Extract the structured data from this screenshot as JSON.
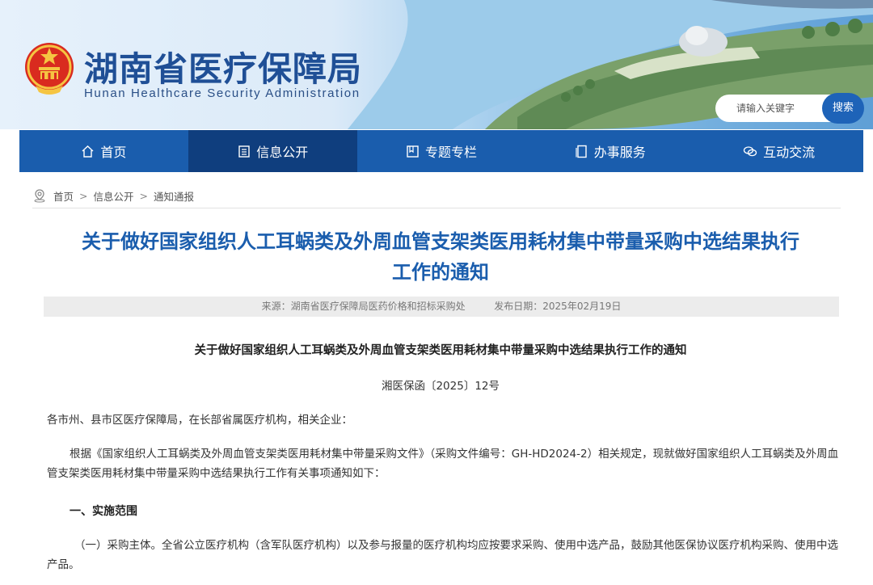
{
  "header": {
    "site_title": "湖南省医疗保障局",
    "site_subtitle": "Hunan Healthcare Security Administration",
    "search_placeholder": "请输入关键字",
    "search_button": "搜索"
  },
  "nav": {
    "items": [
      {
        "label": "首页",
        "icon": "home-icon",
        "active": false
      },
      {
        "label": "信息公开",
        "icon": "list-icon",
        "active": true
      },
      {
        "label": "专题专栏",
        "icon": "book-icon",
        "active": false
      },
      {
        "label": "办事服务",
        "icon": "document-icon",
        "active": false
      },
      {
        "label": "互动交流",
        "icon": "chat-icon",
        "active": false
      }
    ]
  },
  "breadcrumb": [
    "首页",
    "信息公开",
    "通知通报"
  ],
  "article": {
    "title_line1": "关于做好国家组织人工耳蜗类及外周血管支架类医用耗材集中带量采购中选结果执行",
    "title_line2": "工作的通知",
    "source": "来源：湖南省医疗保障局医药价格和招标采购处",
    "publish_date": "发布日期：2025年02月19日",
    "doc_title": "关于做好国家组织人工耳蜗类及外周血管支架类医用耗材集中带量采购中选结果执行工作的通知",
    "doc_number": "湘医保函〔2025〕12号",
    "salutation": "各市州、县市区医疗保障局，在长部省属医疗机构，相关企业：",
    "intro": "根据《国家组织人工耳蜗类及外周血管支架类医用耗材集中带量采购文件》（采购文件编号：GH-HD2024-2）相关规定，现就做好国家组织人工耳蜗类及外周血管支架类医用耗材集中带量采购中选结果执行工作有关事项通知如下：",
    "section1_heading": "一、实施范围",
    "section1_para": "（一）采购主体。全省公立医疗机构（含军队医疗机构）以及参与报量的医疗机构均应按要求采购、使用中选产品，鼓励其他医保协议医疗机构采购、使用中选产品。"
  },
  "colors": {
    "brand_blue": "#1a5dad",
    "nav_active": "#0f3e7e",
    "title_blue": "#1a5dad",
    "meta_bg": "#ececec"
  }
}
